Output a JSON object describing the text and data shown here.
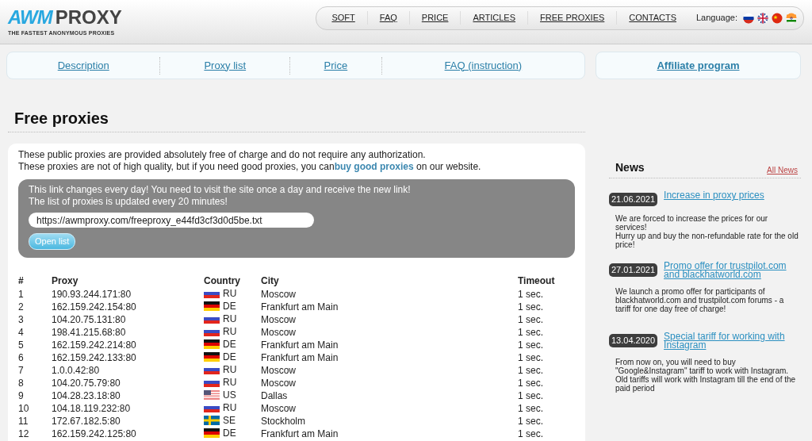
{
  "logo": {
    "mark": "AWM",
    "name": "PROXY",
    "tagline": "THE FASTEST ANONYMOUS PROXIES"
  },
  "top_nav": [
    "SOFT",
    "FAQ",
    "PRICE",
    "ARTICLES",
    "FREE PROXIES",
    "CONTACTS"
  ],
  "language": {
    "label": "Language:",
    "flags": [
      {
        "kind": "ru"
      },
      {
        "kind": "gb"
      },
      {
        "kind": "cn"
      },
      {
        "kind": "in"
      }
    ]
  },
  "sub_nav": [
    "Description",
    "Proxy list",
    "Price",
    "FAQ (instruction)"
  ],
  "affiliate": "Affiliate program",
  "title": "Free proxies",
  "intro": [
    "These public proxies are provided absolutely free of charge and do not require any authorization.",
    "These proxies are not of high quality, but if you need good proxies, you can"
  ],
  "intro_link": "buy good proxies",
  "intro_tail": " on our website.",
  "notice": {
    "lines": [
      "This link changes every day! You need to visit the site once a day and receive the new link!",
      "The list of proxies is updated every 20 minutes!"
    ],
    "url": "https://awmproxy.com/freeproxy_e44fd3cf3d0d5be.txt",
    "button": "Open list"
  },
  "table": {
    "columns": [
      "#",
      "Proxy",
      "Country",
      "City",
      "Timeout"
    ],
    "rows": [
      {
        "n": "1",
        "proxy": "190.93.244.171:80",
        "country": "RU",
        "city": "Moscow",
        "timeout": "1 sec."
      },
      {
        "n": "2",
        "proxy": "162.159.242.154:80",
        "country": "DE",
        "city": "Frankfurt am Main",
        "timeout": "1 sec."
      },
      {
        "n": "3",
        "proxy": "104.20.75.131:80",
        "country": "RU",
        "city": "Moscow",
        "timeout": "1 sec."
      },
      {
        "n": "4",
        "proxy": "198.41.215.68:80",
        "country": "RU",
        "city": "Moscow",
        "timeout": "1 sec."
      },
      {
        "n": "5",
        "proxy": "162.159.242.214:80",
        "country": "DE",
        "city": "Frankfurt am Main",
        "timeout": "1 sec."
      },
      {
        "n": "6",
        "proxy": "162.159.242.133:80",
        "country": "DE",
        "city": "Frankfurt am Main",
        "timeout": "1 sec."
      },
      {
        "n": "7",
        "proxy": "1.0.0.42:80",
        "country": "RU",
        "city": "Moscow",
        "timeout": "1 sec."
      },
      {
        "n": "8",
        "proxy": "104.20.75.79:80",
        "country": "RU",
        "city": "Moscow",
        "timeout": "1 sec."
      },
      {
        "n": "9",
        "proxy": "104.28.23.18:80",
        "country": "US",
        "city": "Dallas",
        "timeout": "1 sec."
      },
      {
        "n": "10",
        "proxy": "104.18.119.232:80",
        "country": "RU",
        "city": "Moscow",
        "timeout": "1 sec."
      },
      {
        "n": "11",
        "proxy": "172.67.182.5:80",
        "country": "SE",
        "city": "Stockholm",
        "timeout": "1 sec."
      },
      {
        "n": "12",
        "proxy": "162.159.242.125:80",
        "country": "DE",
        "city": "Frankfurt am Main",
        "timeout": "1 sec."
      }
    ]
  },
  "news": {
    "title": "News",
    "all_link": "All News",
    "items": [
      {
        "date": "21.06.2021",
        "title": "Increase in proxy prices",
        "text": "We are forced to increase the prices for our services!\nHurry up and buy the non-refundable rate for the old price!"
      },
      {
        "date": "27.01.2021",
        "title": "Promo offer for trustpilot.com and blackhatworld.com",
        "text": "We launch a promo offer for participants of blackhatworld.com and trustpilot.com forums - a tariff for one day free of charge!"
      },
      {
        "date": "13.04.2020",
        "title": "Special tariff for working with Instagram",
        "text": "From now on, you will need to buy \"Google&Instagram\" tariff to work with Instagram. Old tariffs will work with Instagram till the end of the paid period"
      }
    ]
  }
}
